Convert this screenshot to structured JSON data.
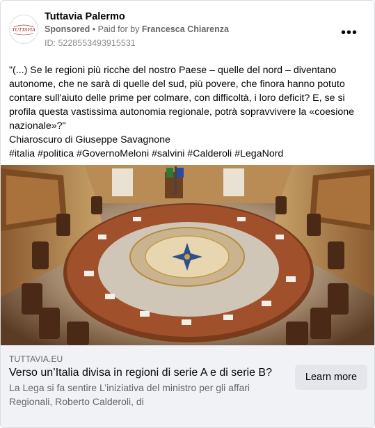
{
  "post": {
    "page_name": "Tuttavia Palermo",
    "avatar_text": "TUTTAVIA",
    "sponsored_label": "Sponsored",
    "separator": " • ",
    "paid_for_prefix": "Paid for by ",
    "paid_for_name": "Francesca Chiarenza",
    "id_text": "ID: 5228553493915531",
    "more_icon": "more-horizontal-icon",
    "more_glyph": "•••",
    "body_lines": [
      "\"(...) Se le regioni più ricche del nostro Paese – quelle del nord – diventano autonome, che ne sarà di quelle del sud, più povere, che finora hanno potuto contare sull'aiuto delle prime per colmare, con difficoltà, i loro deficit? E, se si profila questa vastissima autonomia regionale, potrà sopravvivere la «coesione nazionale»?\"",
      "Chiaroscuro di Giuseppe Savagnone",
      "#italia #politica #GovernoMeloni #salvini #Calderoli #LegaNord"
    ]
  },
  "link_preview": {
    "domain": "TUTTAVIA.EU",
    "headline": "Verso un’Italia divisa in regioni di serie A e di serie B?",
    "description": "La Lega si fa sentire L’iniziativa del ministro per gli affari Regionali, Roberto Calderoli, di",
    "cta_label": "Learn more"
  },
  "colors": {
    "secondary_text": "#65676b",
    "card_border": "#dadde1",
    "link_bg": "#f0f2f5",
    "button_bg": "#e4e6eb"
  }
}
